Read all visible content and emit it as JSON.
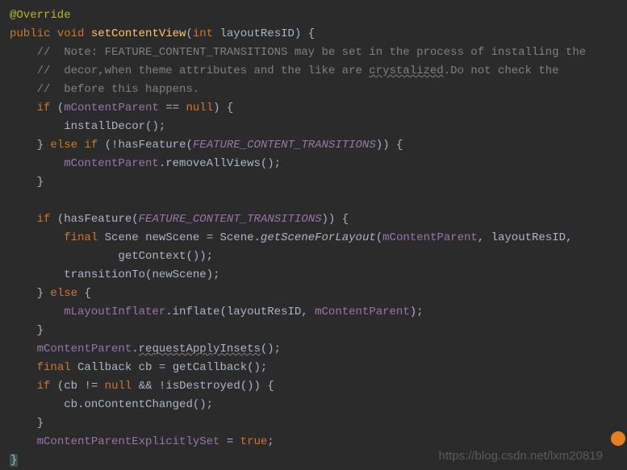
{
  "code": {
    "annotation": "@Override",
    "kw_public": "public",
    "kw_void": "void",
    "method_name": "setContentView",
    "kw_int": "int",
    "param_name": "layoutResID",
    "comment1": "//  Note: FEATURE_CONTENT_TRANSITIONS may be set in the process of installing the",
    "comment2a": "//  decor,when theme attributes and the like are ",
    "comment2b": "crystalized",
    "comment2c": ".Do not check the",
    "comment3": "//  before this happens.",
    "kw_if": "if",
    "kw_else": "else",
    "kw_final": "final",
    "kw_null": "null",
    "kw_true": "true",
    "field_mContentParent": "mContentParent",
    "call_installDecor": "installDecor",
    "call_hasFeature": "hasFeature",
    "const_FCT": "FEATURE_CONTENT_TRANSITIONS",
    "call_removeAllViews": "removeAllViews",
    "type_Scene": "Scene",
    "var_newScene": "newScene",
    "static_getSceneForLayout": "getSceneForLayout",
    "call_getContext": "getContext",
    "call_transitionTo": "transitionTo",
    "field_mLayoutInflater": "mLayoutInflater",
    "call_inflate": "inflate",
    "call_requestApplyInsets": "requestApplyInsets",
    "type_Callback": "Callback",
    "var_cb": "cb",
    "call_getCallback": "getCallback",
    "call_isDestroyed": "isDestroyed",
    "call_onContentChanged": "onContentChanged",
    "field_mCPES": "mContentParentExplicitlySet"
  },
  "watermark": "https://blog.csdn.net/lxm20819"
}
